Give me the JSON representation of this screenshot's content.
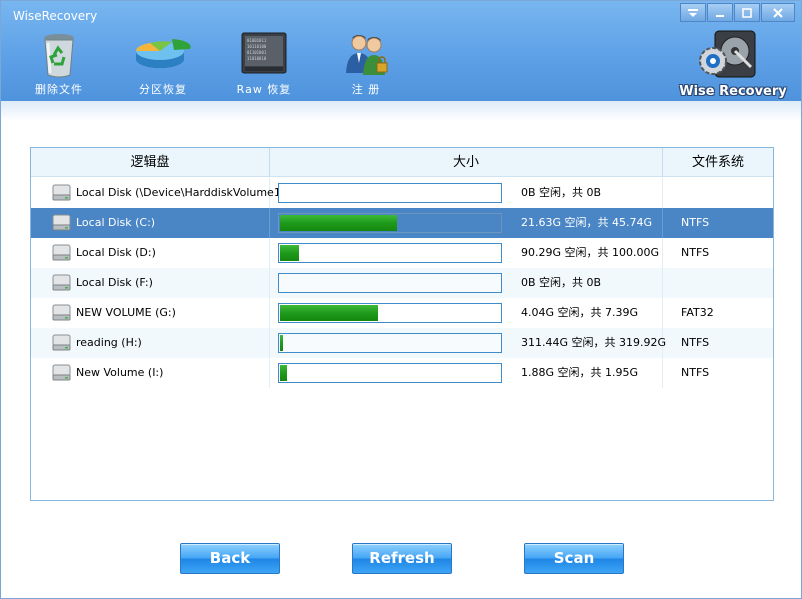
{
  "window": {
    "title": "WiseRecovery",
    "controls": [
      "menu",
      "minimize",
      "maximize",
      "close"
    ]
  },
  "toolbar": {
    "items": [
      {
        "label": "删除文件",
        "icon": "recycle-bin-icon"
      },
      {
        "label": "分区恢复",
        "icon": "partition-pie-icon"
      },
      {
        "label": "Raw 恢复",
        "icon": "raw-disk-icon"
      },
      {
        "label": "注 册",
        "icon": "users-register-icon"
      }
    ],
    "brand": "Wise Recovery"
  },
  "table": {
    "headers": {
      "name": "逻辑盘",
      "size": "大小",
      "filesystem": "文件系统"
    },
    "rows": [
      {
        "name": "Local Disk (\\Device\\HarddiskVolume1)",
        "size": "0B 空闲，共 0B",
        "filesystem": "",
        "used_fraction": 0.0
      },
      {
        "name": "Local Disk (C:)",
        "size": "21.63G 空闲，共 45.74G",
        "filesystem": "NTFS",
        "used_fraction": 0.527,
        "selected": true
      },
      {
        "name": "Local Disk (D:)",
        "size": "90.29G 空闲，共 100.00G",
        "filesystem": "NTFS",
        "used_fraction": 0.087
      },
      {
        "name": "Local Disk (F:)",
        "size": "0B 空闲，共 0B",
        "filesystem": "",
        "used_fraction": 0.0
      },
      {
        "name": "NEW VOLUME (G:)",
        "size": "4.04G 空闲，共 7.39G",
        "filesystem": "FAT32",
        "used_fraction": 0.44
      },
      {
        "name": "reading (H:)",
        "size": "311.44G 空闲，共 319.92G",
        "filesystem": "NTFS",
        "used_fraction": 0.012
      },
      {
        "name": "New Volume (I:)",
        "size": "1.88G 空闲，共 1.95G",
        "filesystem": "NTFS",
        "used_fraction": 0.032
      }
    ]
  },
  "buttons": {
    "back": "Back",
    "refresh": "Refresh",
    "scan": "Scan"
  },
  "colors": {
    "header": "#5c9fe6",
    "selected_row": "#4a86c5",
    "bar_fill": "#1f9a1c",
    "button": "#3da5f4"
  }
}
